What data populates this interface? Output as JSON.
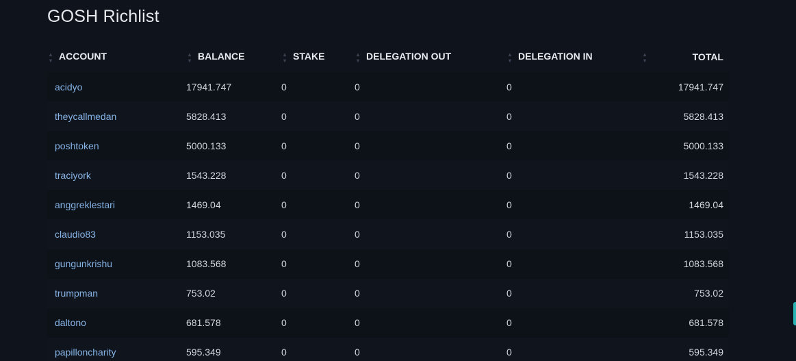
{
  "page": {
    "title": "GOSH Richlist"
  },
  "table": {
    "headers": {
      "account": "ACCOUNT",
      "balance": "BALANCE",
      "stake": "STAKE",
      "delegation_out": "DELEGATION OUT",
      "delegation_in": "DELEGATION IN",
      "total": "TOTAL"
    },
    "rows": [
      {
        "account": "acidyo",
        "balance": "17941.747",
        "stake": "0",
        "delegation_out": "0",
        "delegation_in": "0",
        "total": "17941.747"
      },
      {
        "account": "theycallmedan",
        "balance": "5828.413",
        "stake": "0",
        "delegation_out": "0",
        "delegation_in": "0",
        "total": "5828.413"
      },
      {
        "account": "poshtoken",
        "balance": "5000.133",
        "stake": "0",
        "delegation_out": "0",
        "delegation_in": "0",
        "total": "5000.133"
      },
      {
        "account": "traciyork",
        "balance": "1543.228",
        "stake": "0",
        "delegation_out": "0",
        "delegation_in": "0",
        "total": "1543.228"
      },
      {
        "account": "anggreklestari",
        "balance": "1469.04",
        "stake": "0",
        "delegation_out": "0",
        "delegation_in": "0",
        "total": "1469.04"
      },
      {
        "account": "claudio83",
        "balance": "1153.035",
        "stake": "0",
        "delegation_out": "0",
        "delegation_in": "0",
        "total": "1153.035"
      },
      {
        "account": "gungunkrishu",
        "balance": "1083.568",
        "stake": "0",
        "delegation_out": "0",
        "delegation_in": "0",
        "total": "1083.568"
      },
      {
        "account": "trumpman",
        "balance": "753.02",
        "stake": "0",
        "delegation_out": "0",
        "delegation_in": "0",
        "total": "753.02"
      },
      {
        "account": "daltono",
        "balance": "681.578",
        "stake": "0",
        "delegation_out": "0",
        "delegation_in": "0",
        "total": "681.578"
      },
      {
        "account": "papilloncharity",
        "balance": "595.349",
        "stake": "0",
        "delegation_out": "0",
        "delegation_in": "0",
        "total": "595.349"
      }
    ]
  },
  "icons": {
    "sort": "sort-arrows-icon"
  },
  "colors": {
    "link": "#86b4e6",
    "background": "#0f131c",
    "accent": "#2bb3b3"
  }
}
